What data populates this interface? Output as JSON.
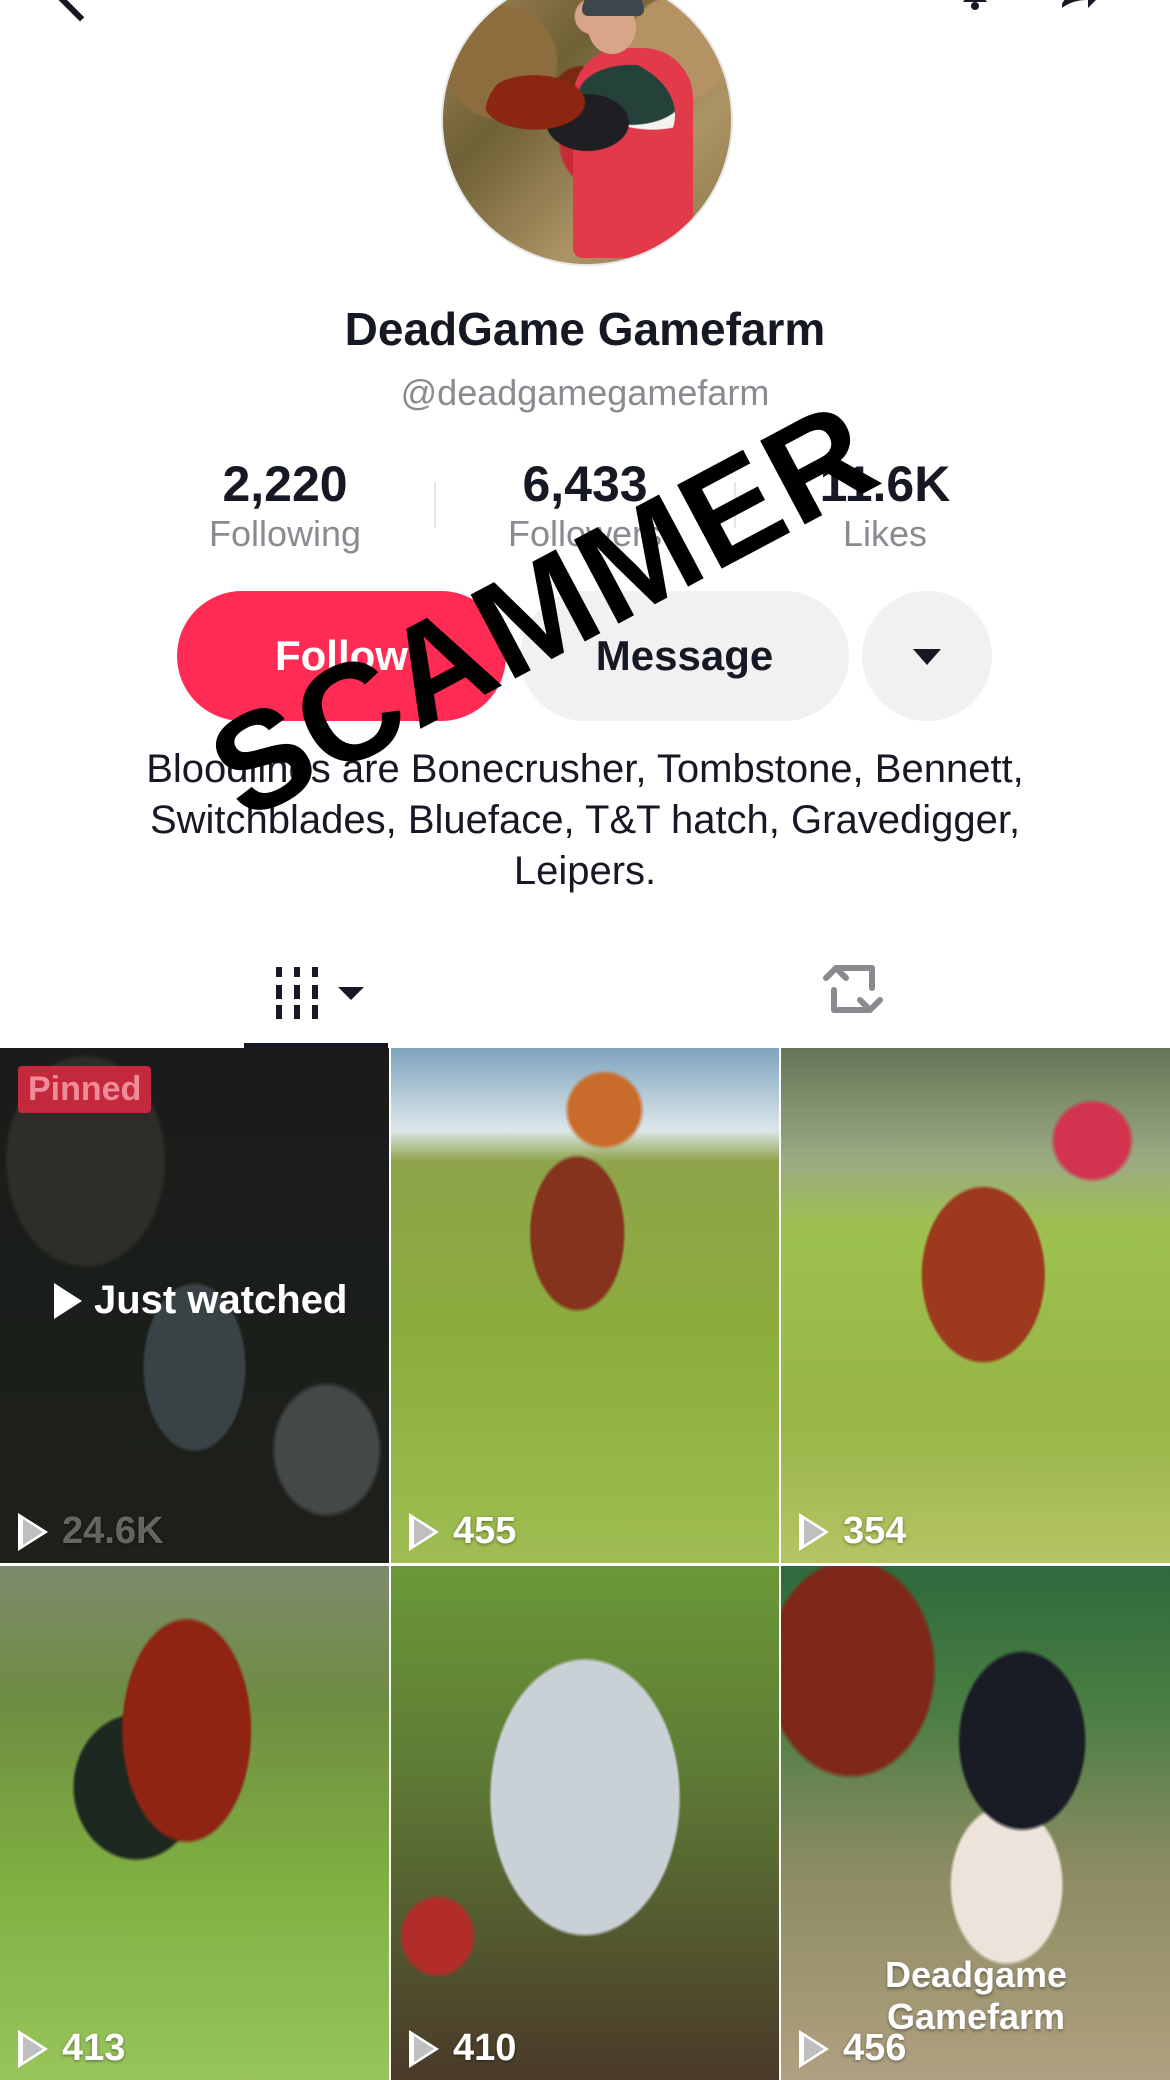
{
  "profile": {
    "display_name": "DeadGame Gamefarm",
    "username": "@deadgamegamefarm",
    "bio": "Bloodlines are Bonecrusher, Tombstone, Bennett, Switchblades, Blueface, T&T hatch, Gravedigger, Leipers."
  },
  "stats": [
    {
      "value": "2,220",
      "label": "Following"
    },
    {
      "value": "6,433",
      "label": "Followers"
    },
    {
      "value": "11.6K",
      "label": "Likes"
    }
  ],
  "buttons": {
    "follow": "Follow",
    "message": "Message"
  },
  "videos": [
    {
      "views": "24.6K",
      "badge": "Pinned",
      "overlay": "Just watched"
    },
    {
      "views": "455"
    },
    {
      "views": "354"
    },
    {
      "views": "413"
    },
    {
      "views": "410"
    },
    {
      "views": "456",
      "caption": "Deadgame Gamefarm"
    }
  ],
  "watermark": {
    "text": "SCAMMER"
  },
  "colors": {
    "follow": "#fe2c55",
    "secondary_button": "#f1f1f2",
    "muted_text": "#8a8b91"
  }
}
